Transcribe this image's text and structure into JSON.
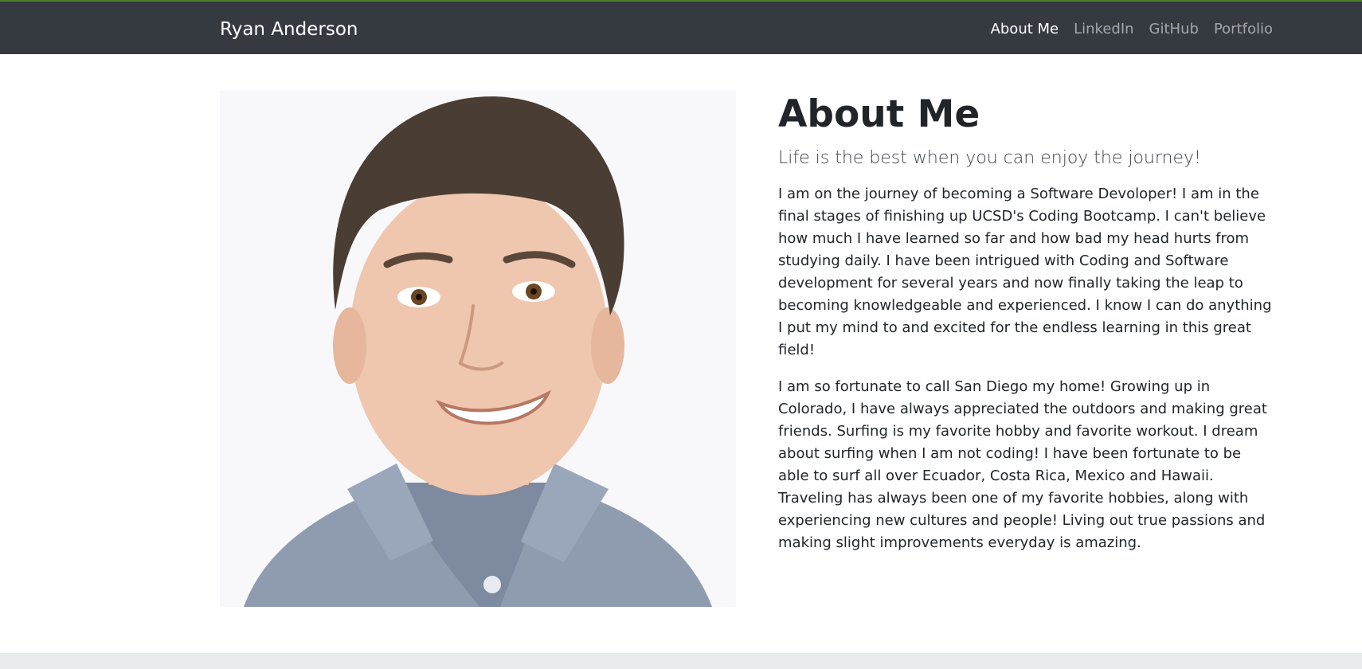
{
  "navbar": {
    "brand": "Ryan Anderson",
    "links": [
      {
        "label": "About Me",
        "active": true
      },
      {
        "label": "LinkedIn",
        "active": false
      },
      {
        "label": "GitHub",
        "active": false
      },
      {
        "label": "Portfolio",
        "active": false
      }
    ]
  },
  "main": {
    "title": "About Me",
    "tagline": "Life is the best when you can enjoy the journey!",
    "paragraphs": [
      "I am on the journey of becoming a Software Devoloper! I am in the final stages of finishing up UCSD's Coding Bootcamp. I can't believe how much I have learned so far and how bad my head hurts from studying daily. I have been intrigued with Coding and Software development for several years and now finally taking the leap to becoming knowledgeable and experienced. I know I can do anything I put my mind to and excited for the endless learning in this great field!",
      "I am so fortunate to call San Diego my home! Growing up in Colorado, I have always appreciated the outdoors and making great friends. Surfing is my favorite hobby and favorite workout. I dream about surfing when I am not coding! I have been fortunate to be able to surf all over Ecuador, Costa Rica, Mexico and Hawaii. Traveling has always been one of my favorite hobbies, along with experiencing new cultures and people! Living out true passions and making slight improvements everyday is amazing."
    ]
  },
  "colors": {
    "navbar_bg": "#343a40",
    "navbar_accent": "#4f7d2e",
    "page_bg": "#ffffff",
    "footer_bg": "#e9ecef",
    "text": "#212529"
  }
}
